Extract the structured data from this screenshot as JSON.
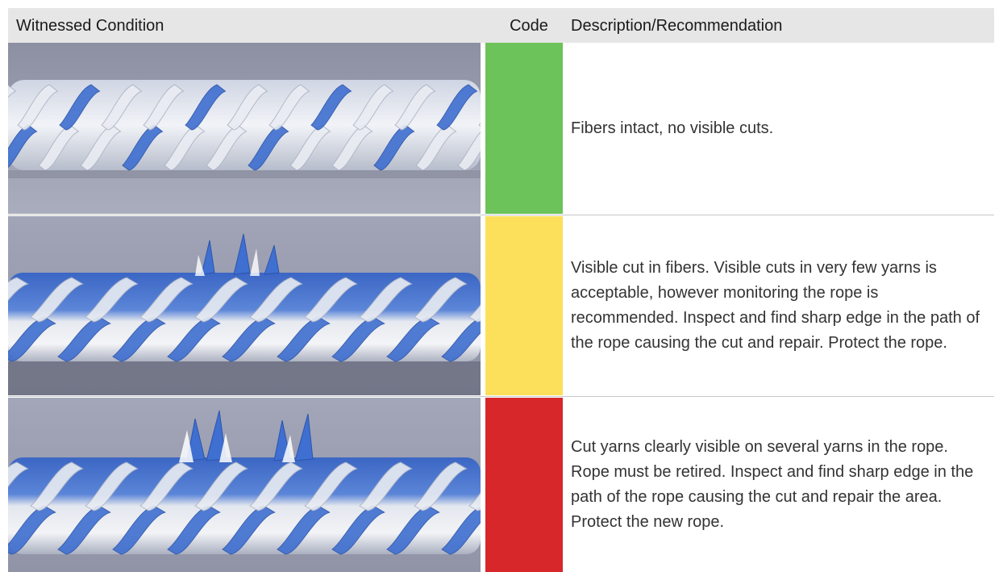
{
  "table": {
    "headers": {
      "condition": "Witnessed Condition",
      "code": "Code",
      "description": "Description/Recommendation"
    },
    "rows": [
      {
        "code_color": "#6cc359",
        "description": "Fibers intact, no visible cuts."
      },
      {
        "code_color": "#fce05b",
        "description": "Visible cut in fibers. Visible cuts in very few yarns is acceptable, however monitoring the rope is recommended. Inspect and find sharp edge in the path of the rope causing the cut and repair. Protect the rope."
      },
      {
        "code_color": "#d7272a",
        "description": "Cut yarns clearly visible on several yarns in the rope. Rope must be retired. Inspect and find sharp edge in the path of the rope causing the cut and repair the area. Protect the new rope."
      }
    ]
  },
  "colors": {
    "header_bg": "#e6e6e6",
    "rope_blue": "#3f6fd0",
    "rope_white": "#e9ecf2",
    "photo_bg": "#9ea3b5"
  }
}
